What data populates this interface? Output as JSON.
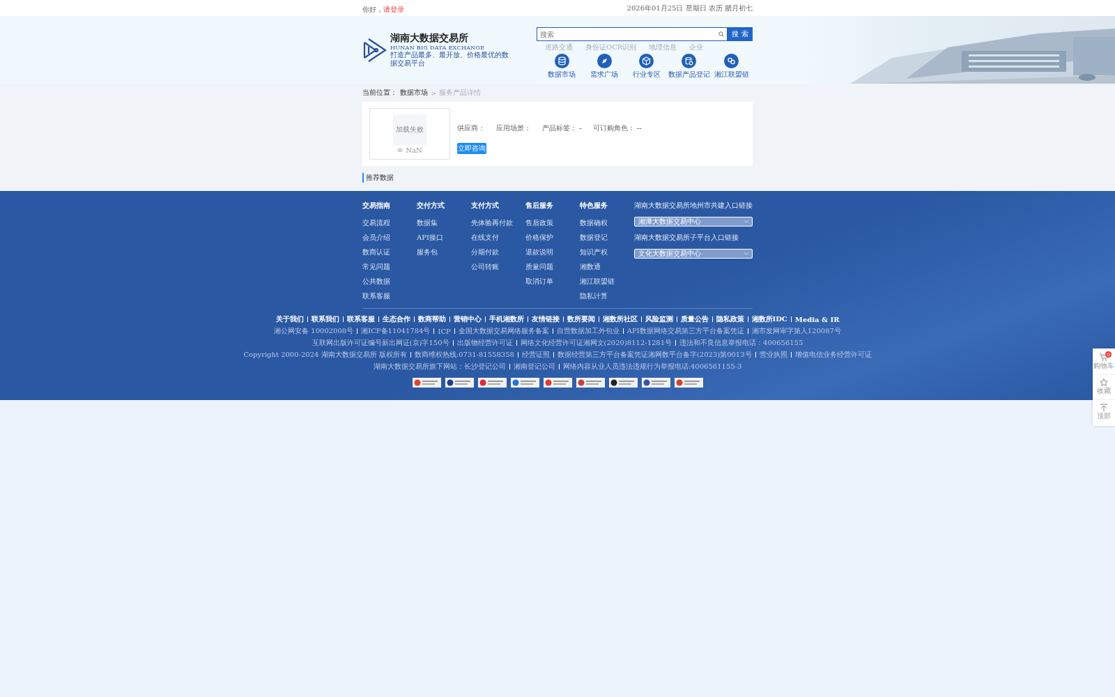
{
  "top_bar": {
    "greeting": "你好，",
    "login_link": "请登录",
    "date": "2026年01月25日 星期日 农历 腊月初七"
  },
  "logo": {
    "name": "湖南大数据交易所",
    "english": "HUNAN BIG DATA EXCHANGE",
    "slogan": "打造产品最多、最开放、价格最优的数据交易平台"
  },
  "search": {
    "placeholder": "搜索",
    "button": "搜 索",
    "hot_tags": [
      "道路交通",
      "身份证OCR识别",
      "地理信息",
      "企业"
    ]
  },
  "nav": [
    {
      "kind": "database",
      "label": "数据市场"
    },
    {
      "kind": "compass",
      "label": "需求广场"
    },
    {
      "kind": "cube",
      "label": "行业专区"
    },
    {
      "kind": "register",
      "label": "数据产品登记"
    },
    {
      "kind": "chain",
      "label": "湘江联盟链"
    }
  ],
  "breadcrumb": {
    "prefix": "当前位置：",
    "items": [
      "数据市场",
      "服务产品详情"
    ],
    "separator": ">"
  },
  "product": {
    "image_error": "加载失败",
    "views": "NaN",
    "fields": [
      {
        "label": "供应商："
      },
      {
        "label": "应用场景："
      },
      {
        "label": "产品标签：",
        "value": "-"
      },
      {
        "label": "可订购角色：",
        "value": "--"
      }
    ],
    "button": "立即咨询"
  },
  "section_title": "推荐数据",
  "footer": {
    "columns": [
      {
        "title": "交易指南",
        "links": [
          "交易流程",
          "会员介绍",
          "数商认证",
          "常见问题",
          "公共数据",
          "联系客服"
        ]
      },
      {
        "title": "交付方式",
        "links": [
          "数据集",
          "API接口",
          "服务包"
        ]
      },
      {
        "title": "支付方式",
        "links": [
          "先体验再付款",
          "在线支付",
          "分期付款",
          "公司转账"
        ]
      },
      {
        "title": "售后服务",
        "links": [
          "售后政策",
          "价格保护",
          "退款说明",
          "质量问题",
          "取消订单"
        ]
      },
      {
        "title": "特色服务",
        "links": [
          "数据确权",
          "数据登记",
          "知识产权",
          "湘数通",
          "湘江联盟链",
          "隐私计算"
        ]
      }
    ],
    "portals": [
      {
        "title": "湖南大数据交易所地州市共建入口链接",
        "value": "湘潭大数据交易中心"
      },
      {
        "title": "湖南大数据交易所子平台入口链接",
        "value": "文化大数据交易中心"
      }
    ],
    "links": [
      "关于我们",
      "联系我们",
      "联系客服",
      "生态合作",
      "数商帮助",
      "营销中心",
      "手机湘数所",
      "友情链接",
      "数所要闻",
      "湘数所社区",
      "风险监测",
      "质量公告",
      "隐私政策",
      "湘数所IDC",
      "Media & IR"
    ],
    "legal_lines": [
      [
        "湘公网安备 10002008号",
        "湘ICP备11041784号",
        "ICP",
        "全国大数据交易网络服务备案",
        "自营数据加工外包业",
        "API数据网络交易第三方平台备案凭证",
        "湘市发网审字第人120087号"
      ],
      [
        "互联网出版许可证编号新出网证(京)字150号",
        "出版物经营许可证",
        "网络文化经营许可证湘网文(2020)8112-1281号",
        "违法和不良信息举报电话：400656155"
      ],
      [
        "Copyright 2000-2024 湖南大数据交易所 版权所有",
        "数商维权热线:0731-81558358",
        "经营证照",
        "数据经营第三方平台备案凭证湘网数平台备字(2023)第0013号",
        "营业执照",
        "增值电信业务经营许可证"
      ],
      [
        "湖南大数据交易所旗下网站：长沙登记公司",
        "湘南登记公司",
        "网络内容从业人员违法违规行为举报电话:4006561155-3"
      ]
    ],
    "badges": [
      {
        "color": "#e0452e"
      },
      {
        "color": "#1f3f8a"
      },
      {
        "color": "#d92c2c"
      },
      {
        "color": "#1e78d8"
      },
      {
        "color": "#e03a2a"
      },
      {
        "color": "#c8433a"
      },
      {
        "color": "#222222"
      },
      {
        "color": "#3a52a8"
      },
      {
        "color": "#d8402a"
      }
    ]
  },
  "side_tools": [
    {
      "kind": "cart",
      "label": "购物车",
      "count": "0"
    },
    {
      "kind": "star",
      "label": "收藏"
    },
    {
      "kind": "top",
      "label": "顶部"
    }
  ]
}
